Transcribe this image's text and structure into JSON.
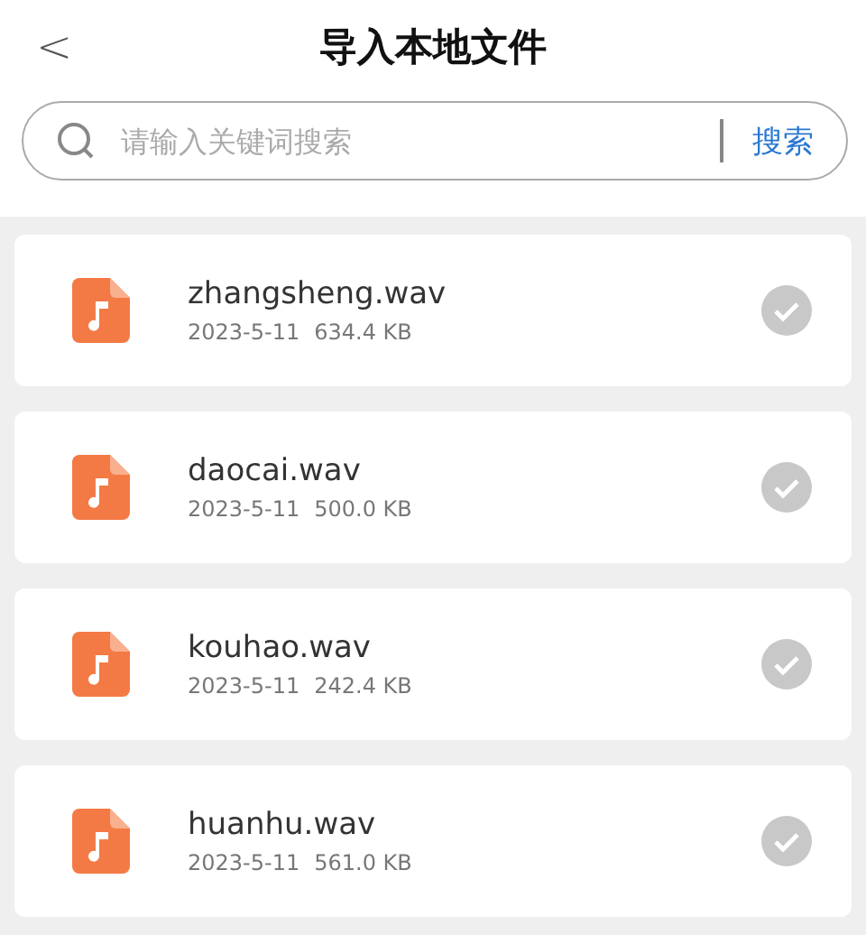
{
  "header": {
    "back": "<",
    "title": "导入本地文件"
  },
  "search": {
    "placeholder": "请输入关键词搜索",
    "button": "搜索"
  },
  "files": [
    {
      "name": "zhangsheng.wav",
      "date": "2023-5-11",
      "size": "634.4 KB",
      "selected": false
    },
    {
      "name": "daocai.wav",
      "date": "2023-5-11",
      "size": "500.0 KB",
      "selected": false
    },
    {
      "name": "kouhao.wav",
      "date": "2023-5-11",
      "size": "242.4 KB",
      "selected": false
    },
    {
      "name": "huanhu.wav",
      "date": "2023-5-11",
      "size": "561.0 KB",
      "selected": false
    }
  ]
}
